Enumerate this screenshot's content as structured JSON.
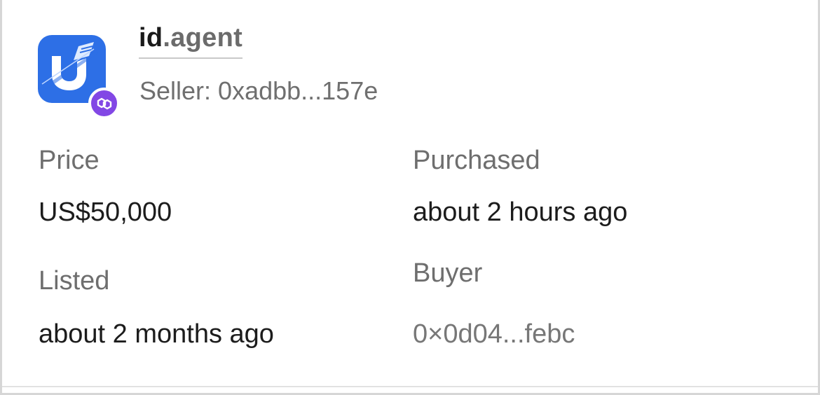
{
  "listing": {
    "domain_name": "id",
    "domain_tld": ".agent",
    "seller_label": "Seller:",
    "seller_address": "0xadbb...157e",
    "logo_icon": "unstoppable-domains-logo-icon",
    "chain_icon": "polygon-icon",
    "colors": {
      "logo_bg": "#2d6fe6",
      "chain_badge": "#8247e5"
    }
  },
  "details": {
    "price_label": "Price",
    "price_value": "US$50,000",
    "purchased_label": "Purchased",
    "purchased_value": "about 2 hours ago",
    "listed_label": "Listed",
    "listed_value": "about 2 months ago",
    "buyer_label": "Buyer",
    "buyer_value": "0×0d04...febc"
  }
}
